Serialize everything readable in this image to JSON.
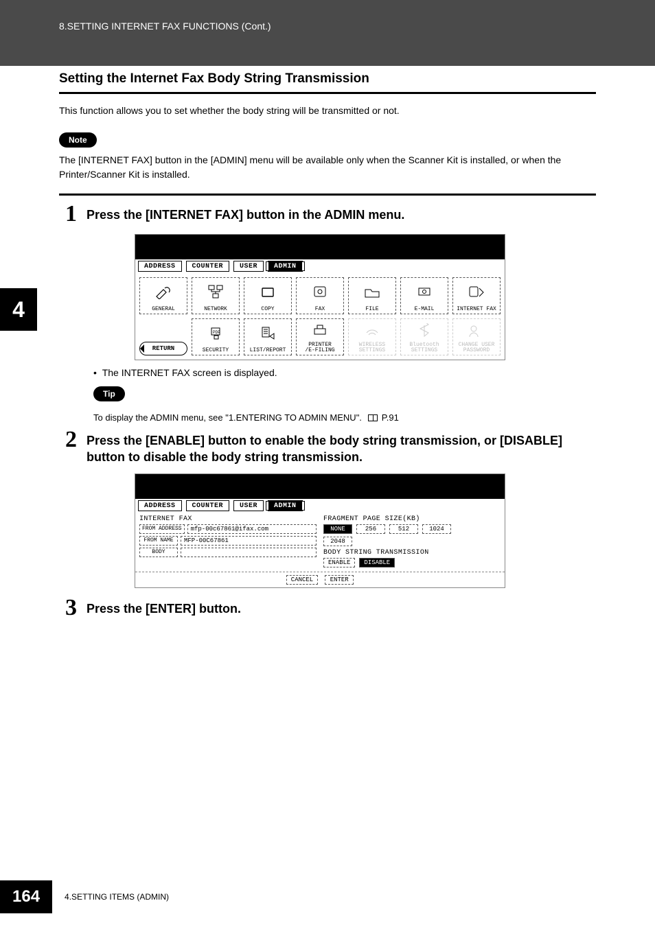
{
  "header": {
    "breadcrumb": "8.SETTING INTERNET FAX FUNCTIONS (Cont.)"
  },
  "section": {
    "title": "Setting the Internet Fax Body String Transmission",
    "intro": "This function allows you to set whether the body string will be transmitted or not."
  },
  "note": {
    "badge": "Note",
    "text": "The [INTERNET FAX] button in the [ADMIN] menu will be available only when the Scanner Kit is installed, or when the Printer/Scanner Kit is installed."
  },
  "steps": [
    {
      "num": "1",
      "text": "Press the [INTERNET FAX] button in the ADMIN menu.",
      "bullet": "The INTERNET FAX screen is displayed."
    },
    {
      "num": "2",
      "text": "Press the [ENABLE] button to enable the body string transmission, or [DISABLE] button to disable the body string transmission."
    },
    {
      "num": "3",
      "text": "Press the [ENTER] button."
    }
  ],
  "tip": {
    "badge": "Tip",
    "text_prefix": "To display the ADMIN menu, see \"1.ENTERING TO ADMIN MENU\".",
    "pageref": "P.91"
  },
  "side_tab": "4",
  "footer": {
    "page": "164",
    "text": "4.SETTING ITEMS (ADMIN)"
  },
  "screen1": {
    "tabs": [
      "ADDRESS",
      "COUNTER",
      "USER",
      "ADMIN"
    ],
    "selected_tab": "ADMIN",
    "return": "RETURN",
    "buttons_row1": [
      "GENERAL",
      "NETWORK",
      "COPY",
      "FAX",
      "FILE",
      "E-MAIL",
      "INTERNET FAX"
    ],
    "buttons_row2": [
      "",
      "SECURITY",
      "LIST/REPORT",
      "PRINTER\n/E-FILING",
      "WIRELESS\nSETTINGS",
      "Bluetooth\nSETTINGS",
      "CHANGE USER\nPASSWORD"
    ]
  },
  "screen2": {
    "tabs": [
      "ADDRESS",
      "COUNTER",
      "USER",
      "ADMIN"
    ],
    "selected_tab": "ADMIN",
    "left_title": "INTERNET FAX",
    "from_address_label": "FROM ADDRESS",
    "from_address_value": "mfp-00c67861@ifax.com",
    "from_name_label": "FROM NAME",
    "from_name_value": "MFP-00C67861",
    "body_label": "BODY",
    "body_value": "",
    "right_title": "FRAGMENT PAGE SIZE(KB)",
    "frag_options": [
      "NONE",
      "256",
      "512",
      "1024",
      "2048"
    ],
    "right_sub": "BODY STRING TRANSMISSION",
    "transmission_options": [
      "ENABLE",
      "DISABLE"
    ],
    "selected_frag": "NONE",
    "selected_trans": "DISABLE",
    "bottom": [
      "CANCEL",
      "ENTER"
    ]
  }
}
